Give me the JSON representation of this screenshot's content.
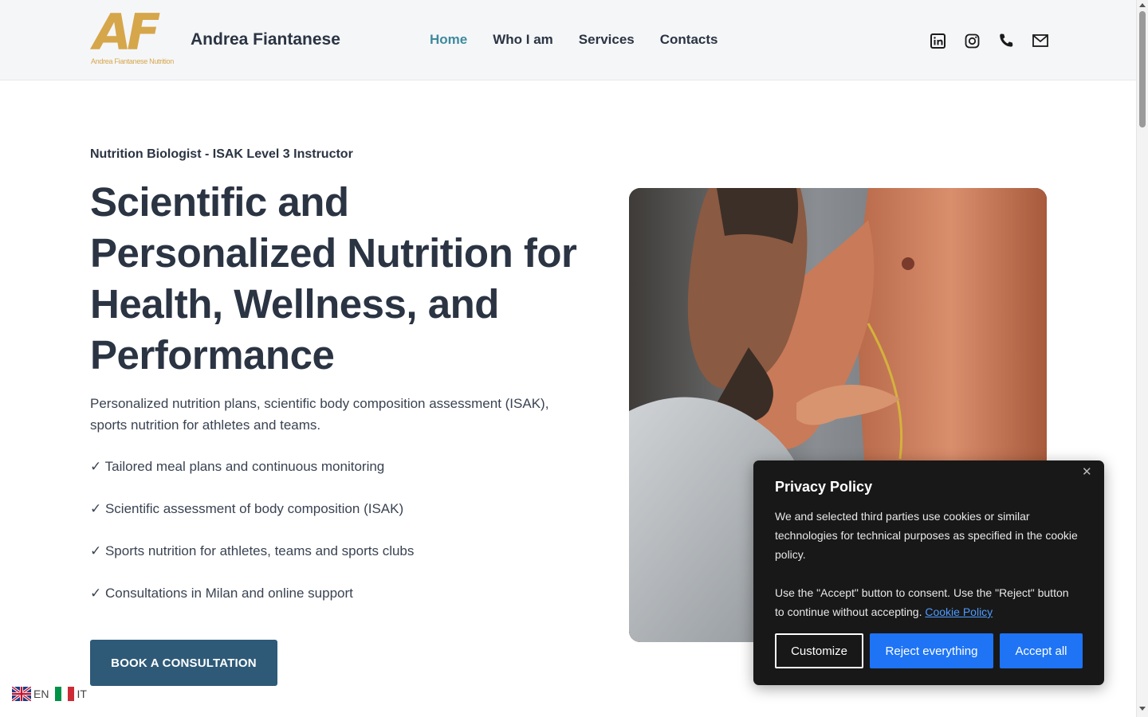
{
  "header": {
    "logo_letters": "AF",
    "logo_subtitle": "Andrea Fiantanese Nutrition",
    "brand_name": "Andrea Fiantanese",
    "nav": [
      {
        "label": "Home",
        "active": true
      },
      {
        "label": "Who I am",
        "active": false
      },
      {
        "label": "Services",
        "active": false
      },
      {
        "label": "Contacts",
        "active": false
      }
    ],
    "social_icons": [
      "linkedin-icon",
      "instagram-icon",
      "phone-icon",
      "mail-icon"
    ],
    "active_color": "#3d8a9e"
  },
  "hero": {
    "eyebrow": "Nutrition Biologist - ISAK Level 3 Instructor",
    "title": "Scientific and Personalized Nutrition for Health, Wellness, and Performance",
    "description": "Personalized nutrition plans, scientific body composition assessment (ISAK), sports nutrition for athletes and teams.",
    "bullets": [
      "✓ Tailored meal plans and continuous monitoring",
      "✓ Scientific assessment of body composition (ISAK)",
      "✓ Sports nutrition for athletes, teams and sports clubs",
      "✓ Consultations in Milan and online support"
    ],
    "cta_label": "BOOK A CONSULTATION",
    "cta_color": "#2e5a78"
  },
  "language": {
    "options": [
      {
        "code": "EN",
        "flag": "uk-flag-icon"
      },
      {
        "code": "IT",
        "flag": "italy-flag-icon"
      }
    ]
  },
  "cookie_banner": {
    "title": "Privacy Policy",
    "text1": "We and selected third parties use cookies or similar technologies for technical purposes as specified in the cookie policy.",
    "text2": "Use the \"Accept\" button to consent. Use the \"Reject\" button to continue without accepting.",
    "link_label": "Cookie Policy",
    "buttons": {
      "customize": "Customize",
      "reject": "Reject everything",
      "accept": "Accept all"
    },
    "accent_color": "#1e74f5"
  }
}
